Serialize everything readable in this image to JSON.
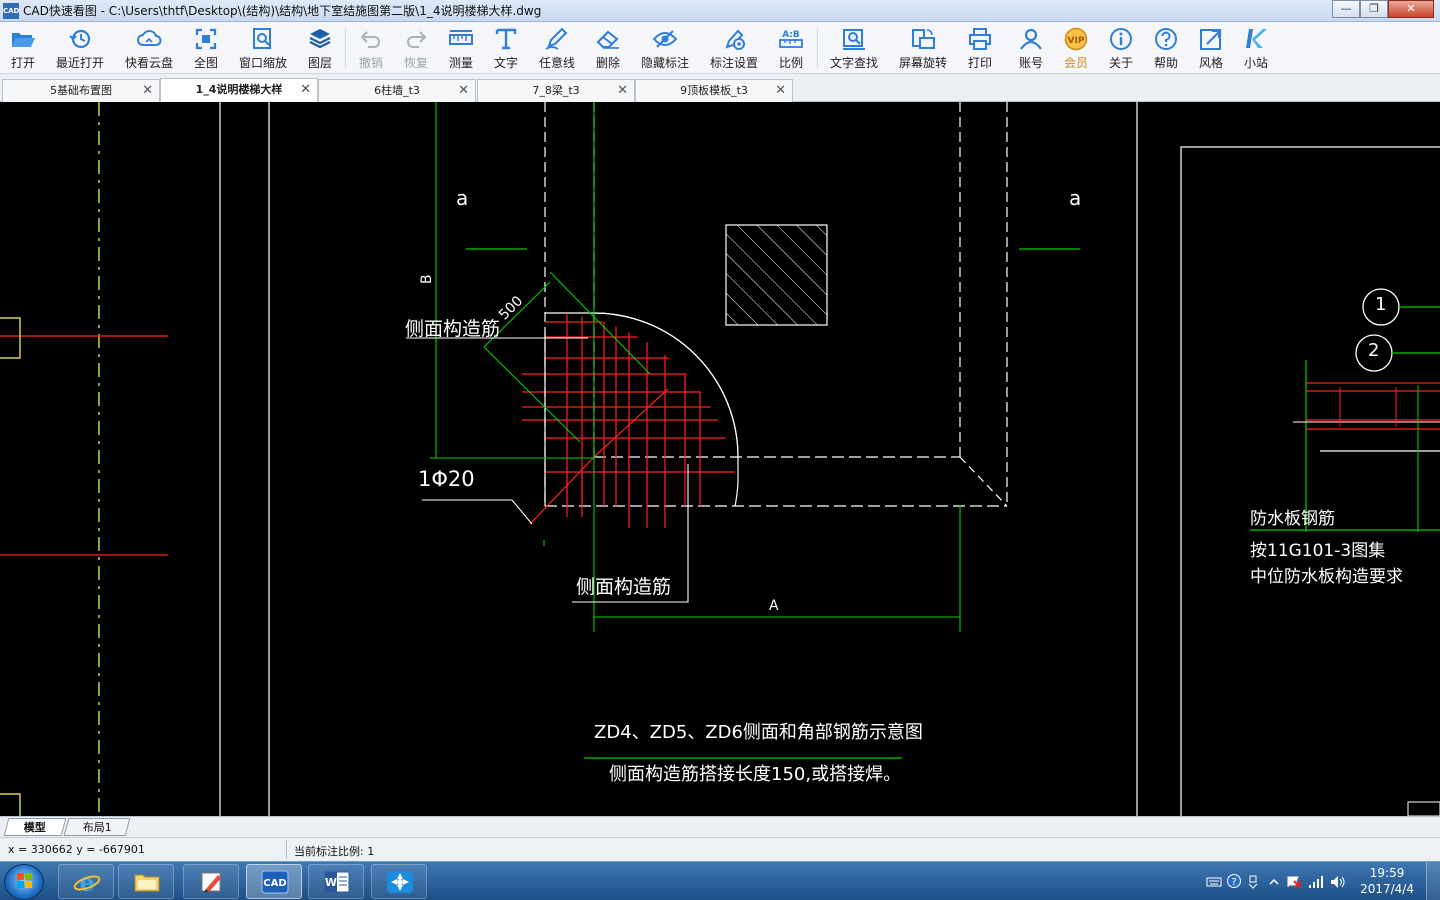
{
  "window": {
    "title": "CAD快速看图 - C:\\Users\\thtf\\Desktop\\(结构)\\结构\\地下室结施图第二版\\1_4说明楼梯大样.dwg",
    "app_icon_text": "CAD",
    "minimize": "—",
    "maximize": "❐",
    "close": "✕"
  },
  "toolbar": {
    "items": [
      {
        "key": "open",
        "label": "打开",
        "icon": "folder-open-icon"
      },
      {
        "key": "recent",
        "label": "最近打开",
        "icon": "history-icon"
      },
      {
        "key": "cloud",
        "label": "快看云盘",
        "icon": "cloud-icon"
      },
      {
        "key": "fullview",
        "label": "全图",
        "icon": "fit-view-icon"
      },
      {
        "key": "zoomwin",
        "label": "窗口缩放",
        "icon": "zoom-window-icon"
      },
      {
        "key": "layers",
        "label": "图层",
        "icon": "layers-icon"
      },
      {
        "key": "undo",
        "label": "撤销",
        "icon": "undo-icon",
        "disabled": true
      },
      {
        "key": "redo",
        "label": "恢复",
        "icon": "redo-icon",
        "disabled": true
      },
      {
        "key": "measure",
        "label": "测量",
        "icon": "ruler-icon"
      },
      {
        "key": "text",
        "label": "文字",
        "icon": "text-icon"
      },
      {
        "key": "freeline",
        "label": "任意线",
        "icon": "pen-icon"
      },
      {
        "key": "delete",
        "label": "删除",
        "icon": "eraser-icon"
      },
      {
        "key": "hidemarks",
        "label": "隐藏标注",
        "icon": "eye-hide-icon"
      },
      {
        "key": "marksettings",
        "label": "标注设置",
        "icon": "mark-settings-icon"
      },
      {
        "key": "scale",
        "label": "比例",
        "icon": "scale-icon"
      },
      {
        "key": "findtext",
        "label": "文字查找",
        "icon": "find-text-icon"
      },
      {
        "key": "rotate",
        "label": "屏幕旋转",
        "icon": "rotate-screen-icon"
      },
      {
        "key": "print",
        "label": "打印",
        "icon": "printer-icon"
      },
      {
        "key": "account",
        "label": "账号",
        "icon": "user-icon"
      },
      {
        "key": "vip",
        "label": "会员",
        "icon": "vip-icon",
        "vip": true,
        "badge": "VIP"
      },
      {
        "key": "about",
        "label": "关于",
        "icon": "info-icon"
      },
      {
        "key": "help",
        "label": "帮助",
        "icon": "help-icon"
      },
      {
        "key": "style",
        "label": "风格",
        "icon": "style-icon"
      },
      {
        "key": "station",
        "label": "小站",
        "icon": "k-logo-icon"
      }
    ]
  },
  "tabs": [
    {
      "label": "5基础布置图",
      "active": false
    },
    {
      "label": "1_4说明楼梯大样",
      "active": true
    },
    {
      "label": "6柱墙_t3",
      "active": false
    },
    {
      "label": "7_8梁_t3",
      "active": false
    },
    {
      "label": "9顶板模板_t3",
      "active": false
    }
  ],
  "tab_close": "✕",
  "drawing": {
    "texts": {
      "a_left": "a",
      "a_right": "a",
      "dim_b": "B",
      "dim_500": "500",
      "side_bar_top": "侧面构造筋",
      "bar_1phi20": "1Φ20",
      "side_bar_bottom": "侧面构造筋",
      "dim_a": "A",
      "caption": "ZD4、ZD5、ZD6侧面和角部钢筋示意图",
      "note": "侧面构造筋搭接长度150,或搭接焊。",
      "waterproof_title": "防水板钢筋",
      "waterproof_line1": "按11G101-3图集",
      "waterproof_line2": "中位防水板构造要求",
      "circle1": "1",
      "circle2": "2"
    }
  },
  "layout_tabs": [
    {
      "label": "模型",
      "active": true
    },
    {
      "label": "布局1",
      "active": false
    }
  ],
  "status": {
    "coords": "x = 330662  y = -667901",
    "scale": "当前标注比例: 1"
  },
  "taskbar": {
    "apps": [
      {
        "name": "ie",
        "icon": "ie-icon"
      },
      {
        "name": "explorer",
        "icon": "folder-icon"
      },
      {
        "name": "paint",
        "icon": "paint-icon"
      },
      {
        "name": "cad",
        "icon": "cad-app-icon",
        "active": true,
        "text": "CAD"
      },
      {
        "name": "word",
        "icon": "word-icon",
        "text": "W"
      },
      {
        "name": "app",
        "icon": "pinwheel-icon"
      }
    ],
    "time": "19:59",
    "date": "2017/4/4"
  },
  "colors": {
    "cad_red": "#ff2020",
    "cad_green": "#00d000",
    "cad_yellow": "#ffff60",
    "cad_white": "#ffffff"
  }
}
